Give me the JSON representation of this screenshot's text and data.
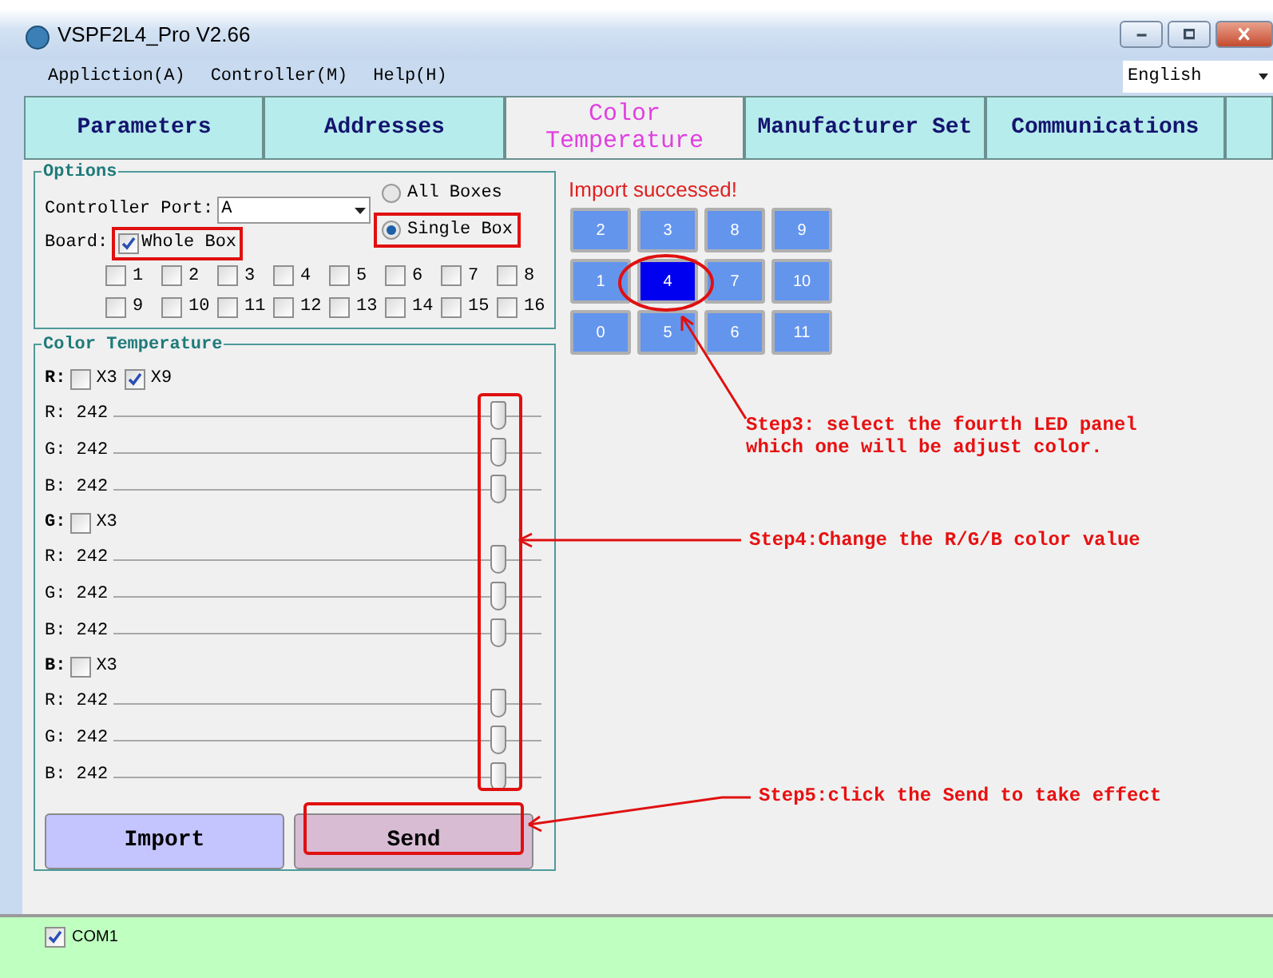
{
  "window": {
    "title": "VSPF2L4_Pro V2.66"
  },
  "menu": [
    "Appliction(A)",
    "Controller(M)",
    "Help(H)"
  ],
  "language": {
    "value": "English"
  },
  "tabs": [
    {
      "label": "Parameters",
      "selected": false
    },
    {
      "label": "Addresses",
      "selected": false
    },
    {
      "label": "Color Temperature",
      "selected": true
    },
    {
      "label": "Manufacturer Set",
      "selected": false
    },
    {
      "label": "Communications",
      "selected": false
    }
  ],
  "options": {
    "title": "Options",
    "port_label": "Controller Port:",
    "port_value": "A",
    "modes": [
      {
        "label": "All Boxes",
        "selected": false
      },
      {
        "label": "Single Box",
        "selected": true
      }
    ],
    "board_label": "Board:",
    "whole_box": {
      "label": "Whole Box",
      "checked": true
    },
    "boards": [
      {
        "label": "1",
        "checked": false
      },
      {
        "label": "2",
        "checked": false
      },
      {
        "label": "3",
        "checked": false
      },
      {
        "label": "4",
        "checked": false
      },
      {
        "label": "5",
        "checked": false
      },
      {
        "label": "6",
        "checked": false
      },
      {
        "label": "7",
        "checked": false
      },
      {
        "label": "8",
        "checked": false
      },
      {
        "label": "9",
        "checked": false
      },
      {
        "label": "10",
        "checked": false
      },
      {
        "label": "11",
        "checked": false
      },
      {
        "label": "12",
        "checked": false
      },
      {
        "label": "13",
        "checked": false
      },
      {
        "label": "14",
        "checked": false
      },
      {
        "label": "15",
        "checked": false
      },
      {
        "label": "16",
        "checked": false
      }
    ]
  },
  "color_temperature": {
    "title": "Color Temperature",
    "groups": [
      {
        "label": "R:",
        "checks": [
          {
            "label": "X3",
            "checked": false
          },
          {
            "label": "X9",
            "checked": true
          }
        ],
        "sliders": [
          {
            "label": "R: 242",
            "level": 0.9
          },
          {
            "label": "G: 242",
            "level": 0.9
          },
          {
            "label": "B: 242",
            "level": 0.9
          }
        ]
      },
      {
        "label": "G:",
        "checks": [
          {
            "label": "X3",
            "checked": false
          }
        ],
        "sliders": [
          {
            "label": "R: 242",
            "level": 0.9
          },
          {
            "label": "G: 242",
            "level": 0.9
          },
          {
            "label": "B: 242",
            "level": 0.9
          }
        ]
      },
      {
        "label": "B:",
        "checks": [
          {
            "label": "X3",
            "checked": false
          }
        ],
        "sliders": [
          {
            "label": "R: 242",
            "level": 0.9
          },
          {
            "label": "G: 242",
            "level": 0.9
          },
          {
            "label": "B: 242",
            "level": 0.9
          }
        ]
      }
    ],
    "buttons": [
      "Import",
      "Send"
    ]
  },
  "status": "Import successed!",
  "panels": [
    {
      "label": "2",
      "selected": false
    },
    {
      "label": "3",
      "selected": false
    },
    {
      "label": "8",
      "selected": false
    },
    {
      "label": "9",
      "selected": false
    },
    {
      "label": "1",
      "selected": false
    },
    {
      "label": "4",
      "selected": true
    },
    {
      "label": "7",
      "selected": false
    },
    {
      "label": "10",
      "selected": false
    },
    {
      "label": "0",
      "selected": false
    },
    {
      "label": "5",
      "selected": false
    },
    {
      "label": "6",
      "selected": false
    },
    {
      "label": "11",
      "selected": false
    }
  ],
  "annotations": [
    "Step3: select the fourth LED panel\nwhich one will be adjust color.",
    "Step4:Change the R/G/B color value",
    "Step5:click the Send to take effect"
  ],
  "ports": [
    {
      "label": "COM1",
      "checked": true
    }
  ]
}
